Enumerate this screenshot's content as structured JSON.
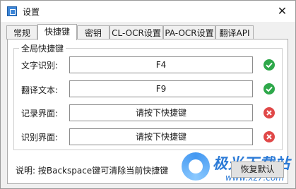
{
  "window": {
    "title": "设置",
    "close_glyph": "✕"
  },
  "tabs": [
    {
      "label": "常规",
      "active": false
    },
    {
      "label": "快捷键",
      "active": true
    },
    {
      "label": "密钥",
      "active": false
    },
    {
      "label": "CL-OCR设置",
      "active": false
    },
    {
      "label": "PA-OCR设置",
      "active": false
    },
    {
      "label": "翻译API",
      "active": false
    }
  ],
  "group": {
    "title": "全局快捷键"
  },
  "rows": [
    {
      "label": "文字识别:",
      "value": "F4",
      "status": "set",
      "status_icon": "check-circle-icon"
    },
    {
      "label": "翻译文本:",
      "value": "F9",
      "status": "set",
      "status_icon": "check-circle-icon"
    },
    {
      "label": "记录界面:",
      "value": "请按下快捷键",
      "status": "unset",
      "status_icon": "x-circle-icon"
    },
    {
      "label": "识别界面:",
      "value": "请按下快捷键",
      "status": "unset",
      "status_icon": "x-circle-icon"
    }
  ],
  "footer": {
    "help_text": "说明: 按Backspace键可清除当前快捷键",
    "restore_label": "恢复默认"
  },
  "watermark": {
    "text": "极光下载站",
    "url": "www.xz7.com"
  },
  "colors": {
    "check": "#2ea84a",
    "cross": "#e04848",
    "accent": "#2b7ad6"
  }
}
